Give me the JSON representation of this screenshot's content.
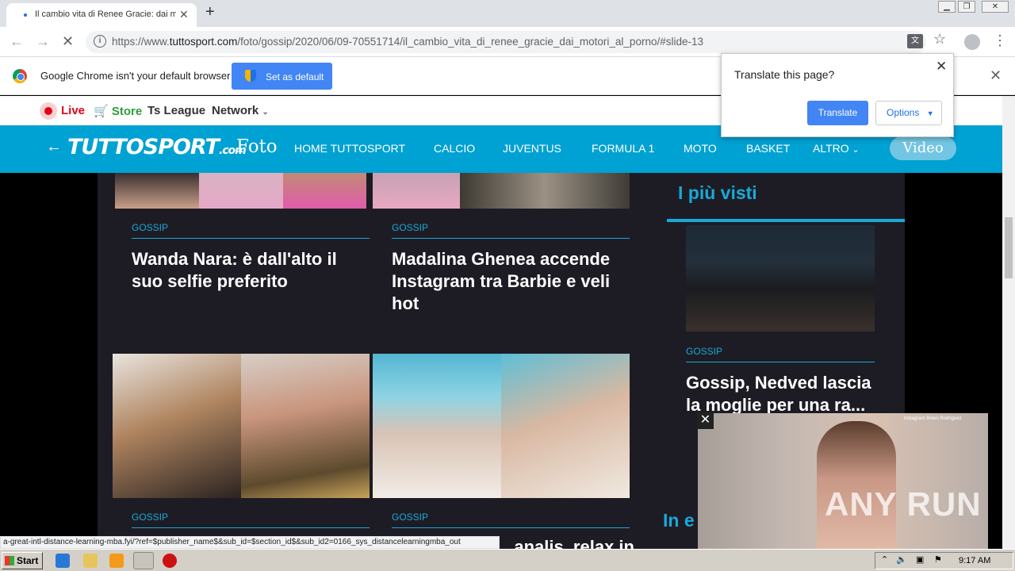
{
  "browser": {
    "tab_title": "Il cambio vita di Renee Gracie: dai m",
    "new_tab": "+",
    "url_prefix": "https://www.",
    "url_domain": "tuttosport.com",
    "url_path": "/foto/gossip/2020/06/09-70551714/il_cambio_vita_di_renee_gracie_dai_motori_al_porno/#slide-13",
    "status_url": "a-great-intl-distance-learning-mba.fyi/?ref=$publisher_name$&sub_id=$section_id$&sub_id2=0166_sys_distancelearningmba_out"
  },
  "infobar": {
    "message": "Google Chrome isn't your default browser",
    "set_default": "Set as default"
  },
  "translate_popup": {
    "question": "Translate this page?",
    "translate": "Translate",
    "options": "Options"
  },
  "site_top": {
    "live": "Live",
    "store": "Store",
    "ts_league": "Ts League",
    "network": "Network"
  },
  "navbar": {
    "logo": "TUTTOSPORT",
    "logo_suffix": ".com",
    "section": "Foto",
    "items": [
      "HOME TUTTOSPORT",
      "CALCIO",
      "JUVENTUS",
      "FORMULA 1",
      "MOTO",
      "BASKET",
      "ALTRO"
    ],
    "video": "Video"
  },
  "articles": [
    {
      "tag": "GOSSIP",
      "title": "Wanda Nara: è dall'alto il suo selfie preferito"
    },
    {
      "tag": "GOSSIP",
      "title": "Madalina Ghenea accende Instagram tra Barbie e veli hot"
    },
    {
      "tag": "GOSSIP",
      "title": ""
    },
    {
      "tag": "GOSSIP",
      "title": "...analis, relax in"
    }
  ],
  "sidebar": {
    "heading": "I più visti",
    "item_tag": "GOSSIP",
    "item_title": "Gossip, Nedved lascia la moglie per una ra...",
    "next_heading": "In e"
  },
  "video_ad": {
    "caption": "Instagram Belen Rodriguez",
    "watermark": "ANY RUN"
  },
  "taskbar": {
    "start": "Start",
    "clock": "9:17 AM"
  }
}
